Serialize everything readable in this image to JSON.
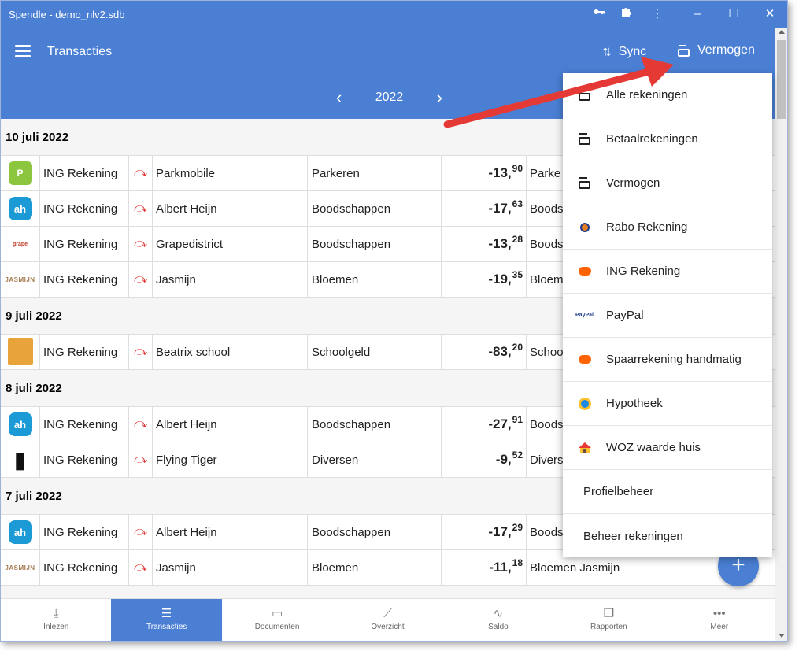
{
  "window": {
    "title": "Spendle - demo_nlv2.sdb"
  },
  "appbar": {
    "title": "Transacties",
    "sync_label": "Sync",
    "vermogen_label": "Vermogen",
    "year": "2022"
  },
  "groups": [
    {
      "date": "10 juli 2022",
      "rows": [
        {
          "logo": "parkmobile-logo",
          "account": "ING Rekening",
          "name": "Parkmobile",
          "category": "Parkeren",
          "amount_main": "-13,",
          "amount_cents": "90",
          "note": "Parke"
        },
        {
          "logo": "albert-heijn-logo",
          "account": "ING Rekening",
          "name": "Albert Heijn",
          "category": "Boodschappen",
          "amount_main": "-17,",
          "amount_cents": "63",
          "note": "Boods"
        },
        {
          "logo": "grapedistrict-logo",
          "account": "ING Rekening",
          "name": "Grapedistrict",
          "category": "Boodschappen",
          "amount_main": "-13,",
          "amount_cents": "28",
          "note": "Boods"
        },
        {
          "logo": "jasmijn-logo",
          "account": "ING Rekening",
          "name": "Jasmijn",
          "category": "Bloemen",
          "amount_main": "-19,",
          "amount_cents": "35",
          "note": "Bloem"
        }
      ]
    },
    {
      "date": "9 juli 2022",
      "rows": [
        {
          "logo": "school-logo",
          "account": "ING Rekening",
          "name": "Beatrix school",
          "category": "Schoolgeld",
          "amount_main": "-83,",
          "amount_cents": "20",
          "note": "Schoo"
        }
      ]
    },
    {
      "date": "8 juli 2022",
      "rows": [
        {
          "logo": "albert-heijn-logo",
          "account": "ING Rekening",
          "name": "Albert Heijn",
          "category": "Boodschappen",
          "amount_main": "-27,",
          "amount_cents": "91",
          "note": "Boods"
        },
        {
          "logo": "flying-tiger-logo",
          "account": "ING Rekening",
          "name": "Flying Tiger",
          "category": "Diversen",
          "amount_main": "-9,",
          "amount_cents": "52",
          "note": "Divers"
        }
      ]
    },
    {
      "date": "7 juli 2022",
      "rows": [
        {
          "logo": "albert-heijn-logo",
          "account": "ING Rekening",
          "name": "Albert Heijn",
          "category": "Boodschappen",
          "amount_main": "-17,",
          "amount_cents": "29",
          "note": "Boods"
        },
        {
          "logo": "jasmijn-logo",
          "account": "ING Rekening",
          "name": "Jasmijn",
          "category": "Bloemen",
          "amount_main": "-11,",
          "amount_cents": "18",
          "note": "Bloemen Jasmijn"
        }
      ]
    }
  ],
  "dropdown": {
    "items": [
      {
        "label": "Alle rekeningen",
        "icon": "wallet-icon"
      },
      {
        "label": "Betaalrekeningen",
        "icon": "wallet-icon"
      },
      {
        "label": "Vermogen",
        "icon": "wallet-icon"
      },
      {
        "label": "Rabo Rekening",
        "icon": "rabo-icon"
      },
      {
        "label": "ING Rekening",
        "icon": "ing-lion-icon"
      },
      {
        "label": "PayPal",
        "icon": "paypal-icon"
      },
      {
        "label": "Spaarrekening handmatig",
        "icon": "ing-lion-icon"
      },
      {
        "label": "Hypotheek",
        "icon": "hypotheek-icon"
      },
      {
        "label": "WOZ waarde huis",
        "icon": "house-icon"
      }
    ],
    "profielbeheer": "Profielbeheer",
    "beheer": "Beheer rekeningen"
  },
  "bottomnav": [
    {
      "label": "Inlezen",
      "icon": "download-icon"
    },
    {
      "label": "Transacties",
      "icon": "transactions-icon",
      "active": true
    },
    {
      "label": "Documenten",
      "icon": "archive-icon"
    },
    {
      "label": "Overzicht",
      "icon": "trend-icon"
    },
    {
      "label": "Saldo",
      "icon": "pulse-icon"
    },
    {
      "label": "Rapporten",
      "icon": "copy-icon"
    },
    {
      "label": "Meer",
      "icon": "more-icon"
    }
  ],
  "fab": {
    "label": "+"
  },
  "colors": {
    "primary": "#4a7fd4",
    "arrow": "#e53935",
    "transfer_icon": "#e0312e"
  }
}
